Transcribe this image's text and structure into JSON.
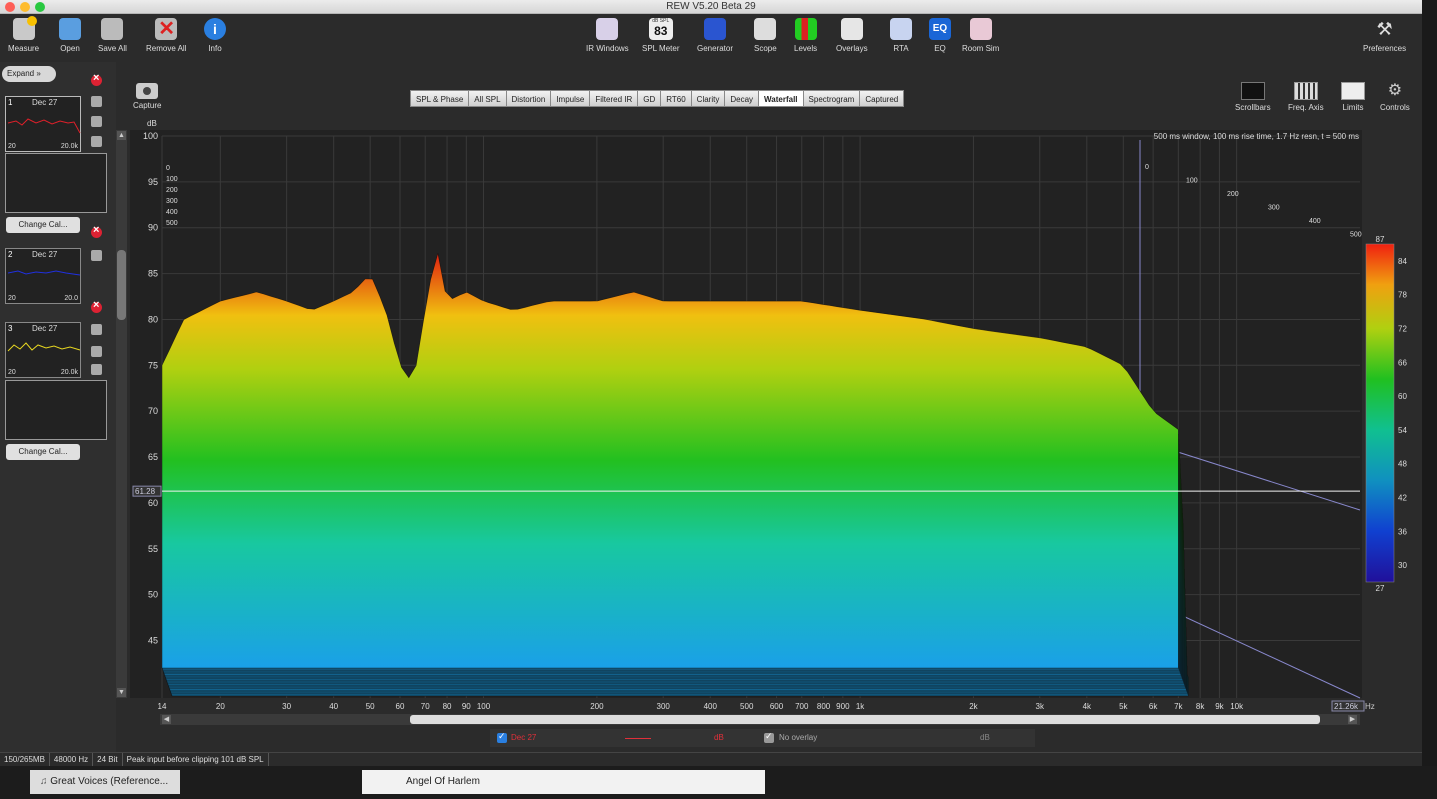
{
  "window": {
    "title": "REW V5.20 Beta 29"
  },
  "toolbar_left": [
    {
      "label": "Measure",
      "icon": "measure-icon"
    },
    {
      "label": "Open",
      "icon": "folder-icon"
    },
    {
      "label": "Save All",
      "icon": "save-icon"
    },
    {
      "label": "Remove All",
      "icon": "remove-icon"
    },
    {
      "label": "Info",
      "icon": "info-icon"
    }
  ],
  "toolbar_center": [
    {
      "label": "IR Windows",
      "icon": "ir-windows-icon"
    },
    {
      "label": "SPL Meter",
      "icon": "spl-meter-icon",
      "badge_top": "dB SPL",
      "badge_value": "83"
    },
    {
      "label": "Generator",
      "icon": "generator-icon"
    },
    {
      "label": "Scope",
      "icon": "scope-icon"
    },
    {
      "label": "Levels",
      "icon": "levels-icon"
    },
    {
      "label": "Overlays",
      "icon": "overlays-icon"
    },
    {
      "label": "RTA",
      "icon": "rta-icon"
    },
    {
      "label": "EQ",
      "icon": "eq-icon"
    },
    {
      "label": "Room Sim",
      "icon": "room-sim-icon"
    }
  ],
  "toolbar_right": {
    "label": "Preferences",
    "icon": "wrench-icon"
  },
  "sidebar": {
    "expand_label": "Expand",
    "measurements": [
      {
        "num": "1",
        "date": "Dec 27",
        "f_low": "20",
        "f_high": "20.0k",
        "color": "#e0202a"
      },
      {
        "num": "2",
        "date": "Dec 27",
        "f_low": "20",
        "f_high": "20.0",
        "color": "#2030e0"
      },
      {
        "num": "3",
        "date": "Dec 27",
        "f_low": "20",
        "f_high": "20.0k",
        "color": "#e8d820"
      }
    ],
    "change_cal_label": "Change Cal..."
  },
  "capture_label": "Capture",
  "tabs": [
    {
      "label": "SPL & Phase",
      "active": false
    },
    {
      "label": "All SPL",
      "active": false
    },
    {
      "label": "Distortion",
      "active": false
    },
    {
      "label": "Impulse",
      "active": false
    },
    {
      "label": "Filtered IR",
      "active": false
    },
    {
      "label": "GD",
      "active": false
    },
    {
      "label": "RT60",
      "active": false
    },
    {
      "label": "Clarity",
      "active": false
    },
    {
      "label": "Decay",
      "active": false
    },
    {
      "label": "Waterfall",
      "active": true
    },
    {
      "label": "Spectrogram",
      "active": false
    },
    {
      "label": "Captured",
      "active": false
    }
  ],
  "graph_controls": [
    {
      "label": "Scrollbars",
      "icon": "scrollbars-icon"
    },
    {
      "label": "Freq. Axis",
      "icon": "freq-axis-icon"
    },
    {
      "label": "Limits",
      "icon": "limits-icon"
    },
    {
      "label": "Controls",
      "icon": "gear-icon"
    }
  ],
  "chart_data": {
    "type": "waterfall",
    "ylabel": "dB",
    "y_ticks": [
      45,
      50,
      55,
      60,
      65,
      70,
      75,
      80,
      85,
      90,
      95,
      100
    ],
    "ylim": [
      42,
      100
    ],
    "x_ticks": [
      "14",
      "20",
      "30",
      "40",
      "50",
      "60",
      "70",
      "80",
      "90",
      "100",
      "200",
      "300",
      "400",
      "500",
      "600",
      "700",
      "800",
      "900",
      "1k",
      "2k",
      "3k",
      "4k",
      "5k",
      "6k",
      "7k",
      "8k",
      "9k",
      "10k"
    ],
    "x_tick_values": [
      14,
      20,
      30,
      40,
      50,
      60,
      70,
      80,
      90,
      100,
      200,
      300,
      400,
      500,
      600,
      700,
      800,
      900,
      1000,
      2000,
      3000,
      4000,
      5000,
      6000,
      7000,
      8000,
      9000,
      10000
    ],
    "xlim": [
      14,
      21260
    ],
    "x_end_label": "21.26k",
    "x_unit": "Hz",
    "time_ticks": [
      "0",
      "100",
      "200",
      "300",
      "400",
      "500"
    ],
    "time_unit": "ms",
    "info_text": "500 ms window, 100 ms rise time,  1.7 Hz resn, t = 500 ms",
    "cursor_value": "61.28",
    "cursor_db": 61.28,
    "colorbar_ticks": [
      "87",
      "84",
      "78",
      "72",
      "66",
      "60",
      "54",
      "48",
      "42",
      "36",
      "30",
      "27"
    ],
    "colorbar_range": [
      27,
      87
    ],
    "front_slice": {
      "freq": [
        14,
        16,
        20,
        25,
        30,
        35,
        40,
        45,
        50,
        55,
        60,
        65,
        70,
        75,
        80,
        90,
        100,
        120,
        150,
        200,
        250,
        300,
        400,
        500,
        700,
        1000,
        1500,
        2000,
        3000,
        4000,
        5000,
        6000,
        7000
      ],
      "db": [
        75,
        80,
        82,
        83,
        82,
        81,
        82,
        83,
        85,
        81,
        75,
        73,
        81,
        88,
        82,
        83,
        82,
        81,
        82,
        82,
        83,
        82,
        82,
        82,
        82,
        81,
        80,
        79,
        78,
        77,
        75,
        70,
        68
      ]
    },
    "back_floor_db": 50
  },
  "legend": {
    "series_name": "Dec 27",
    "series_unit": "dB",
    "overlay_label": "No overlay",
    "overlay_unit": "dB"
  },
  "status": [
    "150/265MB",
    "48000 Hz",
    "24 Bit",
    "Peak input before clipping 101 dB SPL"
  ],
  "dock": [
    {
      "label": "Great Voices (Reference..."
    },
    {
      "label": "Angel Of Harlem"
    }
  ]
}
